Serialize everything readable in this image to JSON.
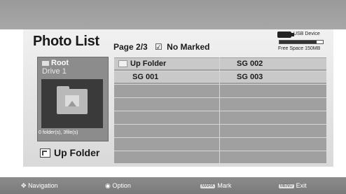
{
  "header": {
    "title": "Photo List",
    "page_text": "Page 2/3",
    "marked_checkbox_icon": "☑",
    "marked_text": "No Marked"
  },
  "usb": {
    "device_label": "USB Device",
    "free_space": "Free Space 150MB",
    "used_fraction": 0.85,
    "icon": "usb-drive-icon"
  },
  "left_panel": {
    "root_label": "Root",
    "drive_label": "Drive 1",
    "count_text": "0 folder(s), 3file(s)",
    "thumbnail_icon": "photo-folder-icon"
  },
  "up_folder_button": {
    "label": "Up Folder",
    "icon": "up-folder-icon"
  },
  "file_grid": {
    "rows": [
      {
        "col1": "Up Folder",
        "col2": "SG 002",
        "col1_icon": "folder-icon"
      },
      {
        "col1": "SG 001",
        "col2": "SG 003"
      },
      {
        "col1": "",
        "col2": ""
      },
      {
        "col1": "",
        "col2": ""
      },
      {
        "col1": "",
        "col2": ""
      },
      {
        "col1": "",
        "col2": ""
      },
      {
        "col1": "",
        "col2": ""
      },
      {
        "col1": "",
        "col2": ""
      }
    ]
  },
  "bottom_bar": {
    "navigation": {
      "label": "Navigation",
      "icon": "dpad-icon"
    },
    "option": {
      "label": "Option",
      "icon": "ok-dot-icon"
    },
    "mark": {
      "label": "Mark",
      "key": "MARK"
    },
    "exit": {
      "label": "Exit",
      "key": "MENU"
    }
  }
}
